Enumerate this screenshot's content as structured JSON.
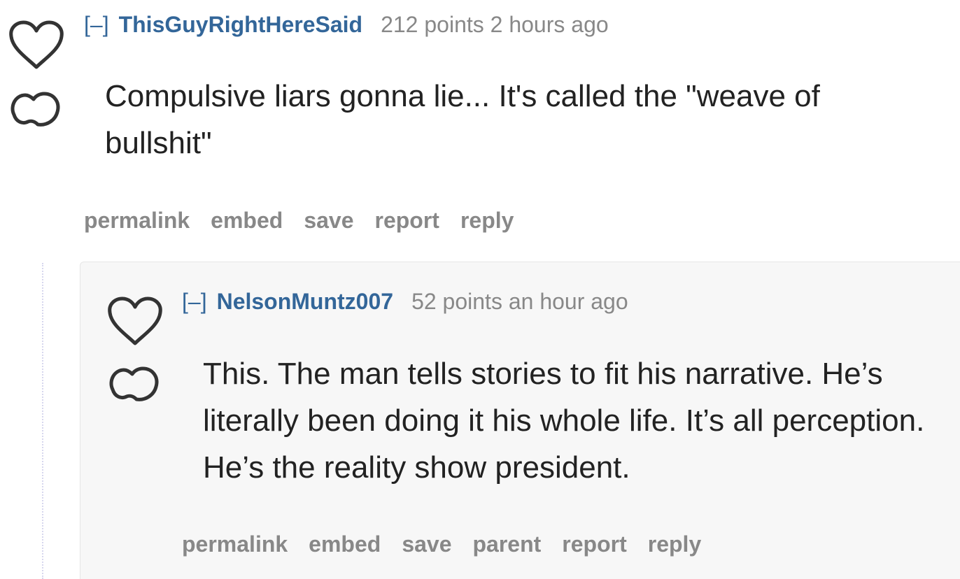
{
  "comments": [
    {
      "collapse_label": "[–]",
      "author": "ThisGuyRightHereSaid",
      "points": "212 points",
      "time": "2 hours ago",
      "body": "Compulsive liars gonna lie... It's called the \"weave of bullshit\"",
      "actions": {
        "permalink": "permalink",
        "embed": "embed",
        "save": "save",
        "report": "report",
        "reply": "reply"
      }
    },
    {
      "collapse_label": "[–]",
      "author": "NelsonMuntz007",
      "points": "52 points",
      "time": "an hour ago",
      "body": "This. The man tells stories to fit his narrative. He’s literally been doing it his whole life. It’s all perception. He’s the reality show president.",
      "actions": {
        "permalink": "permalink",
        "embed": "embed",
        "save": "save",
        "parent": "parent",
        "report": "report",
        "reply": "reply"
      }
    }
  ],
  "icons": {
    "upvote": "heart-outline-icon",
    "downvote": "blob-outline-icon"
  },
  "colors": {
    "author": "#336699",
    "meta": "#888888",
    "body": "#222222",
    "child_background": "#f7f7f7"
  }
}
